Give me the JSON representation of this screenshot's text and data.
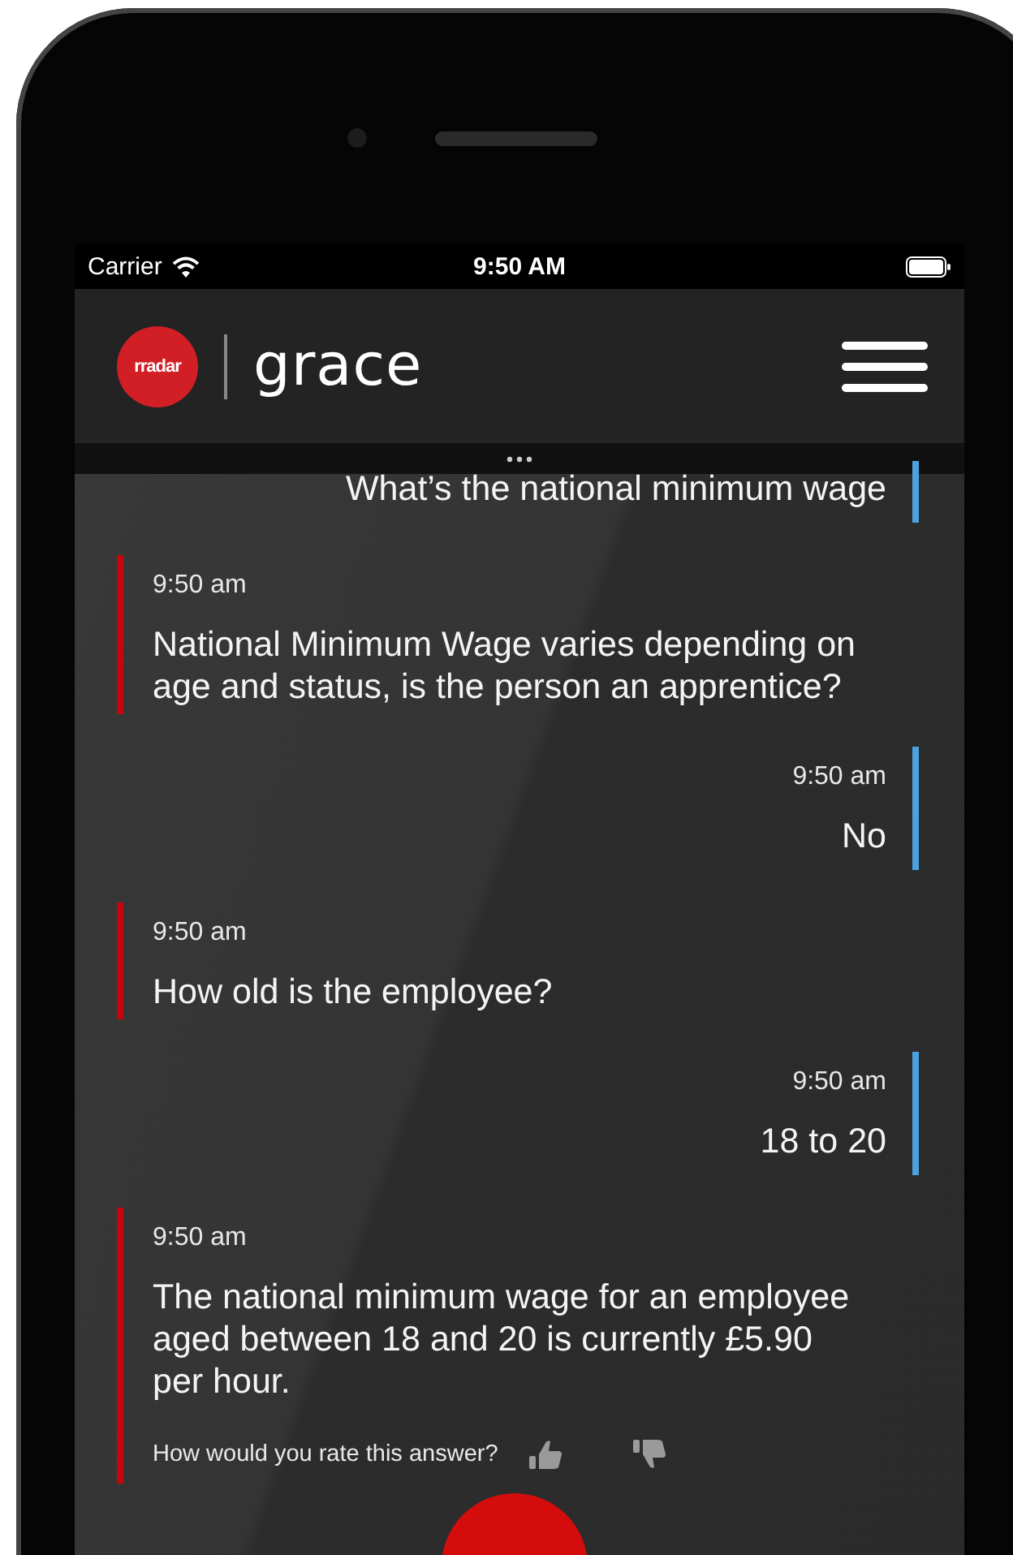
{
  "status_bar": {
    "carrier": "Carrier",
    "time": "9:50 AM"
  },
  "header": {
    "logo_text": "rradar",
    "app_name": "grace"
  },
  "messages": [
    {
      "kind": "user",
      "text": "What’s the national minimum wage"
    },
    {
      "kind": "bot",
      "time": "9:50 am",
      "text": "National Minimum Wage varies depending on age and status, is the person an apprentice?"
    },
    {
      "kind": "user",
      "time": "9:50 am",
      "text": "No"
    },
    {
      "kind": "bot",
      "time": "9:50 am",
      "text": "How old is the employee?"
    },
    {
      "kind": "user",
      "time": "9:50 am",
      "text": "18 to 20"
    },
    {
      "kind": "bot",
      "time": "9:50 am",
      "text": "The national minimum wage for an employee aged between 18 and 20 is currently £5.90 per hour.",
      "rating_prompt": "How would you rate this answer?"
    }
  ]
}
